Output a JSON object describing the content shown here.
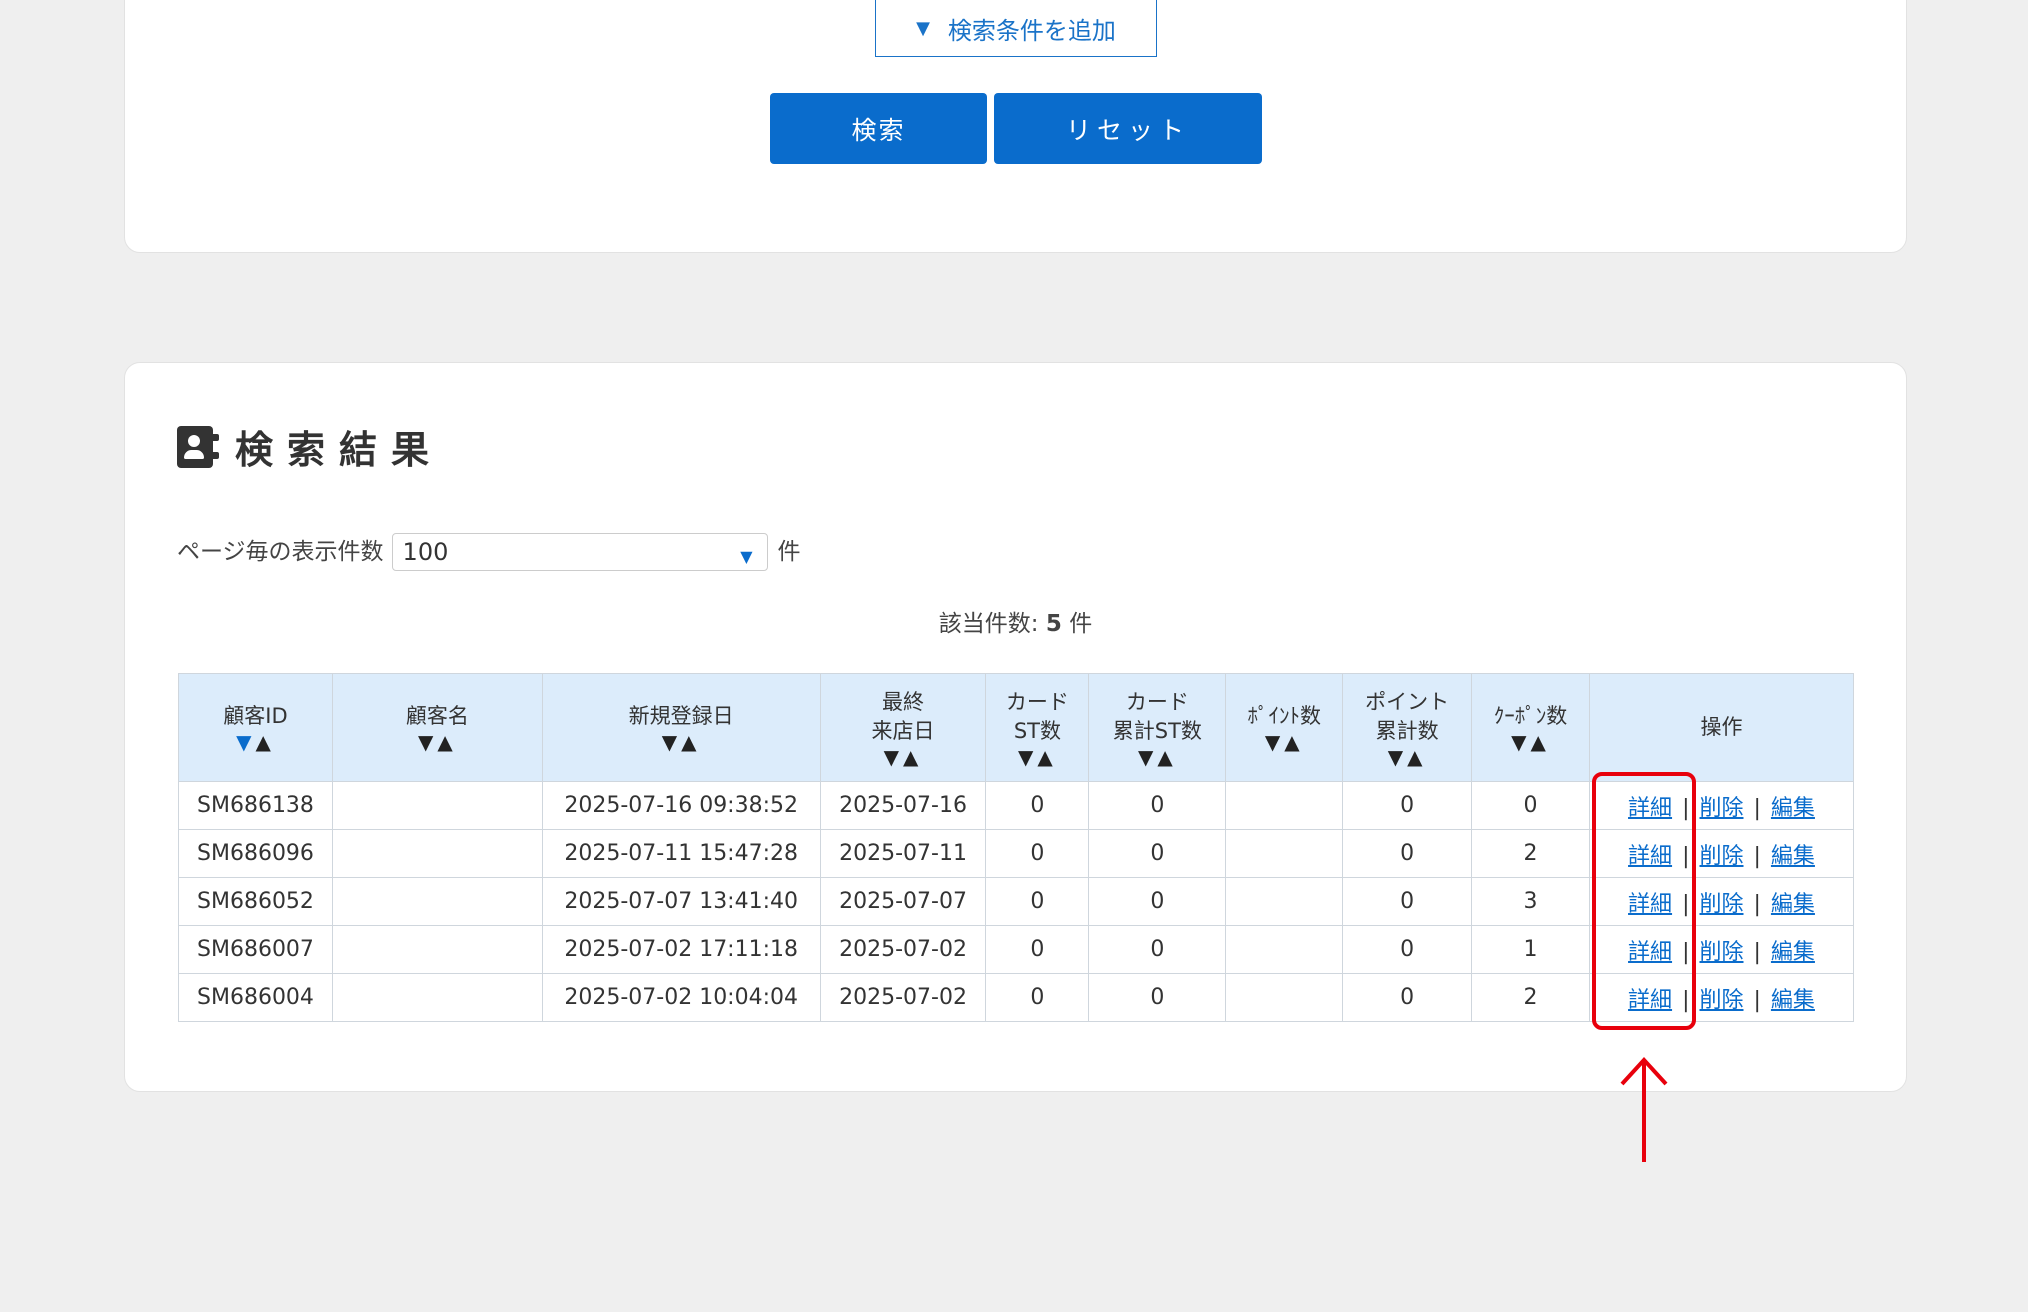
{
  "search": {
    "add_condition_label": "検索条件を追加",
    "search_button": "検索",
    "reset_button": "リセット"
  },
  "results": {
    "title": "検索結果",
    "per_page_label": "ページ毎の表示件数",
    "per_page_value": "100",
    "per_page_unit": "件",
    "count_label": "該当件数:",
    "count_value": "5",
    "count_unit": "件",
    "columns": [
      {
        "line1": "顧客ID",
        "line2": ""
      },
      {
        "line1": "顧客名",
        "line2": ""
      },
      {
        "line1": "新規登録日",
        "line2": ""
      },
      {
        "line1": "最終",
        "line2": "来店日"
      },
      {
        "line1": "カード",
        "line2": "ST数"
      },
      {
        "line1": "カード",
        "line2": "累計ST数"
      },
      {
        "line1": "ﾎﾟｲﾝﾄ数",
        "line2": ""
      },
      {
        "line1": "ポイント",
        "line2": "累計数"
      },
      {
        "line1": "ｸｰﾎﾟﾝ数",
        "line2": ""
      },
      {
        "line1": "操作",
        "line2": ""
      }
    ],
    "sort_down": "▼",
    "sort_up": "▲",
    "ops": {
      "detail": "詳細",
      "delete": "削除",
      "edit": "編集",
      "sep": "|"
    },
    "rows": [
      {
        "id": "SM686138",
        "name": "",
        "registered": "2025-07-16 09:38:52",
        "last_visit": "2025-07-16",
        "card_st": "0",
        "card_total_st": "0",
        "points": "",
        "points_total": "0",
        "coupons": "0"
      },
      {
        "id": "SM686096",
        "name": "",
        "registered": "2025-07-11 15:47:28",
        "last_visit": "2025-07-11",
        "card_st": "0",
        "card_total_st": "0",
        "points": "",
        "points_total": "0",
        "coupons": "2"
      },
      {
        "id": "SM686052",
        "name": "",
        "registered": "2025-07-07 13:41:40",
        "last_visit": "2025-07-07",
        "card_st": "0",
        "card_total_st": "0",
        "points": "",
        "points_total": "0",
        "coupons": "3"
      },
      {
        "id": "SM686007",
        "name": "",
        "registered": "2025-07-02 17:11:18",
        "last_visit": "2025-07-02",
        "card_st": "0",
        "card_total_st": "0",
        "points": "",
        "points_total": "0",
        "coupons": "1"
      },
      {
        "id": "SM686004",
        "name": "",
        "registered": "2025-07-02 10:04:04",
        "last_visit": "2025-07-02",
        "card_st": "0",
        "card_total_st": "0",
        "points": "",
        "points_total": "0",
        "coupons": "2"
      }
    ]
  },
  "colors": {
    "accent": "#0a6ccc",
    "highlight": "#e8000c",
    "header_bg": "#dcecfb"
  }
}
